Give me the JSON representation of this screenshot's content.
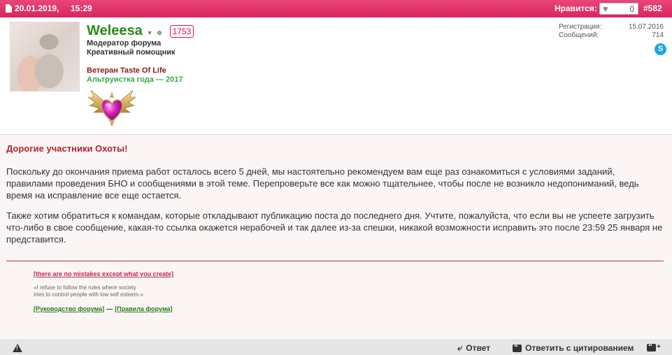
{
  "header": {
    "date": "20.01.2019,",
    "time": "15:29",
    "likes_label": "Нравится:",
    "likes_count": "0",
    "post_number": "#582"
  },
  "user": {
    "name": "Weleesa",
    "reputation": "1753",
    "role_primary": "Модератор форума",
    "role_secondary": "Креативный помощник",
    "title_veteran": "Ветеран Taste Of Life",
    "title_award": "Альтруистка года — 2017",
    "award_icon": "winged-heart-icon",
    "stats": {
      "registered_label": "Регистрация:",
      "registered_value": "15.07.2016",
      "messages_label": "Сообщений:",
      "messages_value": "714"
    },
    "contact_icon": "skype-icon"
  },
  "message": {
    "heading": "Дорогие участники Охоты!",
    "paragraph1": "Поскольку до окончания приема работ осталось всего 5 дней, мы настоятельно рекомендуем вам еще раз ознакомиться с условиями заданий, правилами проведения БНО и сообщениями в этой теме. Перепроверьте все как можно тщательнее, чтобы после не возникло недопониманий, ведь время на исправление все еще остается.",
    "paragraph2": "Также хотим обратиться к командам, которые откладывают публикацию поста до последнего дня. Учтите, пожалуйста, что если вы не успеете загрузить что-либо в свое сообщение, какая-то ссылка окажется нерабочей и так далее из-за спешки, никакой возможности исправить это после 23:59 25 января не представится."
  },
  "signature": {
    "link1": "[there are no mistakes except what you create]",
    "quote_line1": "«I refuse to follow the rules where society",
    "quote_line2": "tries to control people with low self esteem.»",
    "link_guide": "[Руководство форума]",
    "separator": "—",
    "link_rules": "[Правила форума]"
  },
  "footer": {
    "reply_label": "Ответ",
    "quote_label": "Ответить с цитированием"
  },
  "colors": {
    "header_bg": "#e03a6e",
    "username": "#2a8a1a",
    "heading": "#b4232a",
    "signature_line": "#c8283f"
  }
}
